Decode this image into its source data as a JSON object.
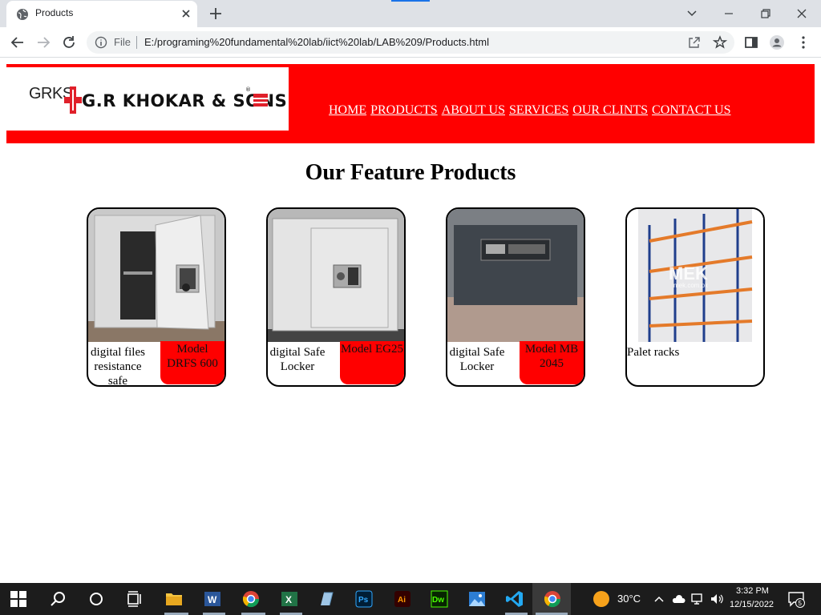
{
  "browser": {
    "tab_title": "Products",
    "file_label": "File",
    "url": "E:/programing%20fundamental%20lab/iict%20lab/LAB%209/Products.html"
  },
  "site": {
    "logo": {
      "grks": "GRKS",
      "name": "G.R KHOKAR & SONS",
      "reg": "®"
    },
    "nav": [
      "HOME",
      "PRODUCTS",
      "ABOUT US",
      "SERVICES",
      "OUR CLINTS",
      "CONTACT US"
    ],
    "heading": "Our Feature Products",
    "products": [
      {
        "name": "digital files resistance safe",
        "model": "Model DRFS 600"
      },
      {
        "name": "digital Safe Locker",
        "model": "Model EG25"
      },
      {
        "name": "digital Safe Locker",
        "model": "Model MB 2045"
      },
      {
        "name": "Palet racks",
        "watermark": "MEK",
        "watermark_sub": "mek.com.pk"
      }
    ]
  },
  "taskbar": {
    "temperature": "30°C",
    "time": "3:32 PM",
    "date": "12/15/2022",
    "notifications": "5"
  },
  "colors": {
    "brand_red": "#ff0000",
    "taskbar": "#1c1c1c",
    "chrome_bg": "#dee1e6"
  }
}
